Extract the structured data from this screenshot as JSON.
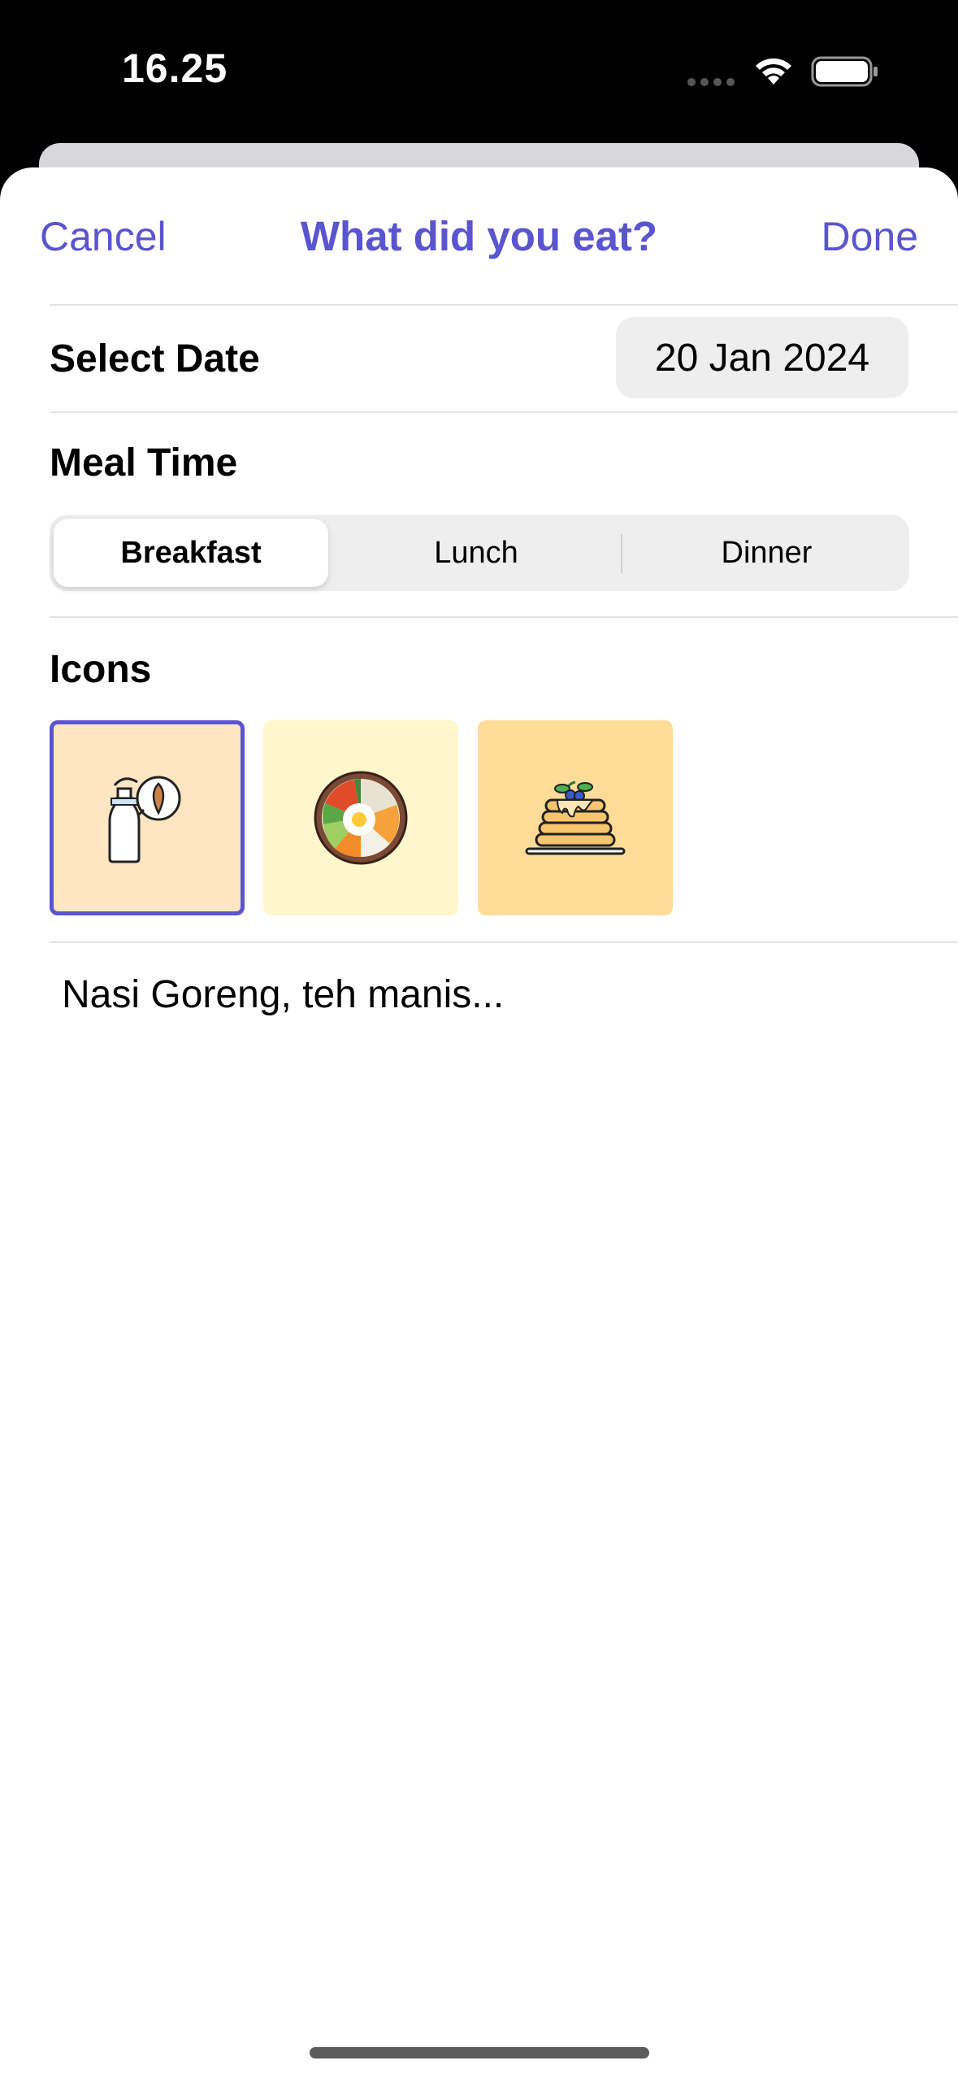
{
  "status_bar": {
    "time": "16.25",
    "signal_icon": "signal-dots-icon",
    "wifi_icon": "wifi-icon",
    "battery_icon": "battery-icon"
  },
  "nav": {
    "cancel_label": "Cancel",
    "title": "What did you eat?",
    "done_label": "Done"
  },
  "date_row": {
    "label": "Select Date",
    "value": "20 Jan 2024"
  },
  "meal_time": {
    "label": "Meal Time",
    "options": [
      "Breakfast",
      "Lunch",
      "Dinner"
    ],
    "selected": "Breakfast"
  },
  "icons_section": {
    "label": "Icons",
    "items": [
      {
        "name": "milk-bottle-almond-icon",
        "background": "#ffe6c2",
        "selected": true
      },
      {
        "name": "bibimbap-bowl-icon",
        "background": "#fff7cc",
        "selected": false
      },
      {
        "name": "pancakes-icon",
        "background": "#ffdd99",
        "selected": false
      }
    ]
  },
  "notes": {
    "placeholder": "Nasi Goreng, teh manis..."
  },
  "colors": {
    "accent": "#5a55cf",
    "sheet_background": "#ffffff",
    "control_background": "#eeeeef"
  }
}
